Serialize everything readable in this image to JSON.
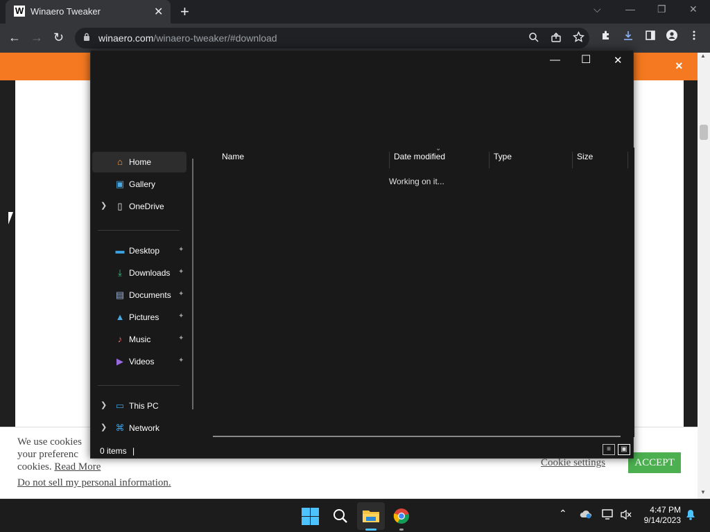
{
  "browser": {
    "tab_title": "Winaero Tweaker",
    "favicon_letter": "W",
    "tab_close": "✕",
    "new_tab": "+",
    "url_host": "winaero.com",
    "url_path": "/winaero-tweaker/#download",
    "window_controls": {
      "tab_search": "⌵",
      "minimize": "—",
      "restore": "❐",
      "close": "✕"
    },
    "nav": {
      "back": "←",
      "forward": "→",
      "reload": "↻"
    }
  },
  "webpage": {
    "banner_close": "×",
    "cookie_text_1": "We use cookies",
    "cookie_text_2": "your preferenc",
    "cookie_text_3": "cookies.",
    "read_more": "Read More",
    "do_not_sell": "Do not sell my personal information",
    "period": ".",
    "cookie_settings": "Cookie settings",
    "accept": "ACCEPT",
    "scroll_up": "▲",
    "scroll_down": "▼"
  },
  "explorer": {
    "controls": {
      "minimize": "—",
      "maximize": "☐",
      "close": "✕"
    },
    "nav_items": [
      {
        "label": "Home",
        "icon": "⌂",
        "icon_color": "#f0a050",
        "selected": true
      },
      {
        "label": "Gallery",
        "icon": "▣",
        "icon_color": "#4aa8e0"
      },
      {
        "label": "OneDrive",
        "icon": "▯",
        "icon_color": "#e8e8e8",
        "expandable": true
      }
    ],
    "quick_access": [
      {
        "label": "Desktop",
        "icon": "▬",
        "icon_color": "#3aa0e0"
      },
      {
        "label": "Downloads",
        "icon": "⤓",
        "icon_color": "#3cc08a"
      },
      {
        "label": "Documents",
        "icon": "▤",
        "icon_color": "#9ab0d8"
      },
      {
        "label": "Pictures",
        "icon": "▲",
        "icon_color": "#4aa8e0"
      },
      {
        "label": "Music",
        "icon": "♪",
        "icon_color": "#e86a6a"
      },
      {
        "label": "Videos",
        "icon": "▶",
        "icon_color": "#9a6ae0"
      }
    ],
    "pin": "📌",
    "locations": [
      {
        "label": "This PC",
        "icon": "▭",
        "icon_color": "#3aa0e0"
      },
      {
        "label": "Network",
        "icon": "⌘",
        "icon_color": "#3aa0e0"
      }
    ],
    "columns": [
      "Name",
      "Date modified",
      "Type",
      "Size"
    ],
    "status_message": "Working on it...",
    "item_count": "0 items",
    "caret": "|",
    "sort_indicator": "⌄"
  },
  "taskbar": {
    "time": "4:47 PM",
    "date": "9/14/2023",
    "search_icon": "⌕",
    "tray_chevron": "⌃"
  },
  "colors": {
    "orange_banner": "#f47920",
    "accept_green": "#4caf50",
    "windows_blue": "#4cc2ff"
  }
}
